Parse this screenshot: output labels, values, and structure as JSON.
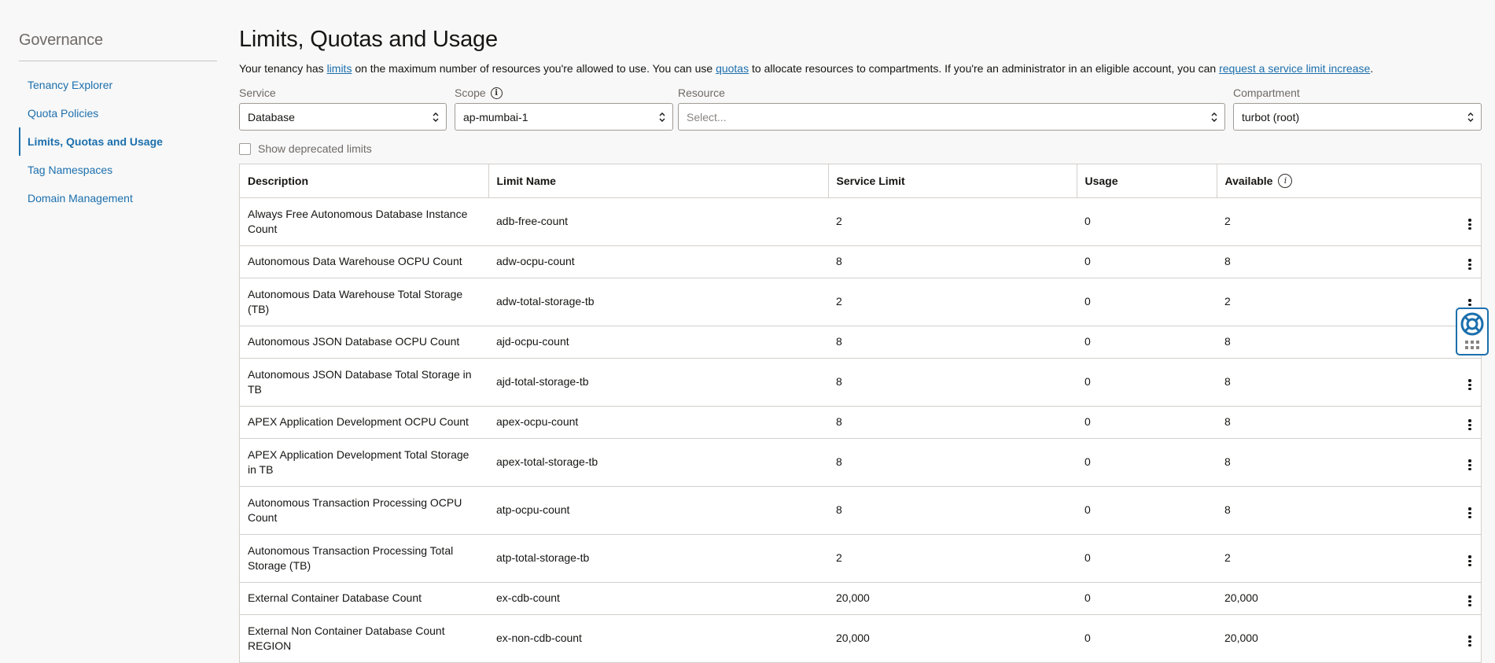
{
  "sidebar": {
    "title": "Governance",
    "items": [
      {
        "label": "Tenancy Explorer"
      },
      {
        "label": "Quota Policies"
      },
      {
        "label": "Limits, Quotas and Usage"
      },
      {
        "label": "Tag Namespaces"
      },
      {
        "label": "Domain Management"
      }
    ],
    "active_index": 2
  },
  "page": {
    "title": "Limits, Quotas and Usage",
    "intro_1": "Your tenancy has ",
    "intro_link_1": "limits",
    "intro_2": " on the maximum number of resources you're allowed to use. You can use ",
    "intro_link_2": "quotas",
    "intro_3": " to allocate resources to compartments. If you're an administrator in an eligible account, you can ",
    "intro_link_3": "request a service limit increase",
    "intro_4": "."
  },
  "filters": {
    "service": {
      "label": "Service",
      "value": "Database"
    },
    "scope": {
      "label": "Scope",
      "value": "ap-mumbai-1"
    },
    "resource": {
      "label": "Resource",
      "placeholder": "Select..."
    },
    "compartment": {
      "label": "Compartment",
      "value": "turbot (root)"
    }
  },
  "deprecated_checkbox": {
    "label": "Show deprecated limits",
    "checked": false
  },
  "table": {
    "headers": {
      "description": "Description",
      "limit_name": "Limit Name",
      "service_limit": "Service Limit",
      "usage": "Usage",
      "available": "Available"
    },
    "rows": [
      {
        "description": "Always Free Autonomous Database Instance Count",
        "limit_name": "adb-free-count",
        "service_limit": "2",
        "usage": "0",
        "available": "2"
      },
      {
        "description": "Autonomous Data Warehouse OCPU Count",
        "limit_name": "adw-ocpu-count",
        "service_limit": "8",
        "usage": "0",
        "available": "8"
      },
      {
        "description": "Autonomous Data Warehouse Total Storage (TB)",
        "limit_name": "adw-total-storage-tb",
        "service_limit": "2",
        "usage": "0",
        "available": "2"
      },
      {
        "description": "Autonomous JSON Database OCPU Count",
        "limit_name": "ajd-ocpu-count",
        "service_limit": "8",
        "usage": "0",
        "available": "8"
      },
      {
        "description": "Autonomous JSON Database Total Storage in TB",
        "limit_name": "ajd-total-storage-tb",
        "service_limit": "8",
        "usage": "0",
        "available": "8"
      },
      {
        "description": "APEX Application Development OCPU Count",
        "limit_name": "apex-ocpu-count",
        "service_limit": "8",
        "usage": "0",
        "available": "8"
      },
      {
        "description": "APEX Application Development Total Storage in TB",
        "limit_name": "apex-total-storage-tb",
        "service_limit": "8",
        "usage": "0",
        "available": "8"
      },
      {
        "description": "Autonomous Transaction Processing OCPU Count",
        "limit_name": "atp-ocpu-count",
        "service_limit": "8",
        "usage": "0",
        "available": "8"
      },
      {
        "description": "Autonomous Transaction Processing Total Storage (TB)",
        "limit_name": "atp-total-storage-tb",
        "service_limit": "2",
        "usage": "0",
        "available": "2"
      },
      {
        "description": "External Container Database Count",
        "limit_name": "ex-cdb-count",
        "service_limit": "20,000",
        "usage": "0",
        "available": "20,000"
      },
      {
        "description": "External Non Container Database Count REGION",
        "limit_name": "ex-non-cdb-count",
        "service_limit": "20,000",
        "usage": "0",
        "available": "20,000"
      }
    ]
  },
  "icons": {
    "info": "info-icon",
    "select_arrows": "up-down-chevron-icon",
    "row_actions": "kebab-menu-icon",
    "help": "lifebuoy-help-icon"
  },
  "colors": {
    "link": "#1b6fad",
    "background": "#f8f8f8",
    "border": "#d3cfcb"
  }
}
